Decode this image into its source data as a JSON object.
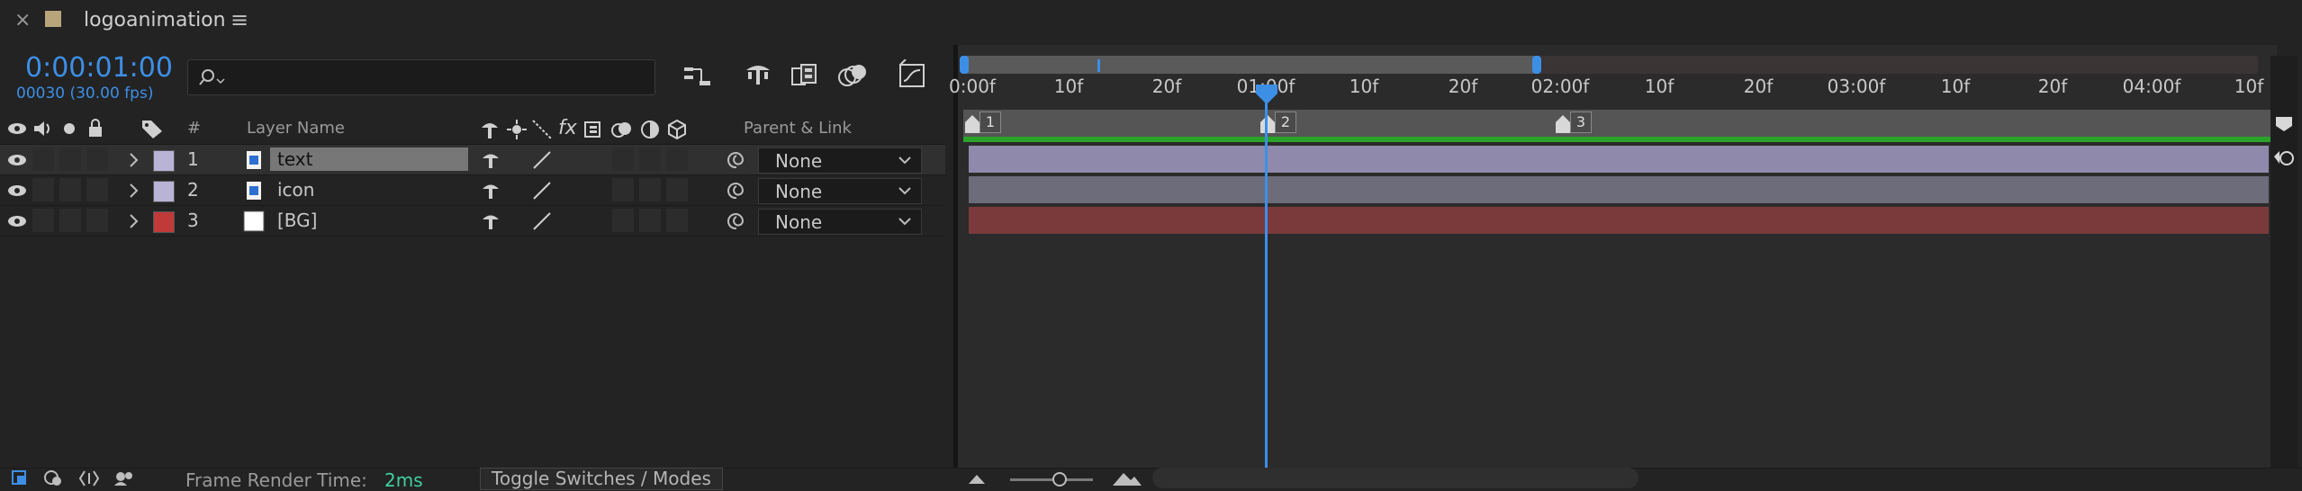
{
  "panel": {
    "close_glyph": "×",
    "comp_name": "logoanimation",
    "menu_glyph": "≡"
  },
  "time": {
    "timecode": "0:00:01:00",
    "frame_fps": "00030 (30.00 fps)"
  },
  "search": {
    "value": "",
    "placeholder": ""
  },
  "columns": {
    "number": "#",
    "layer_name": "Layer Name",
    "parent_link": "Parent & Link",
    "fx": "fx"
  },
  "layers": [
    {
      "index": "1",
      "name": "text",
      "label_color": "#b9b3d6",
      "parent": "None",
      "selected": true
    },
    {
      "index": "2",
      "name": "icon",
      "label_color": "#b9b3d6",
      "parent": "None",
      "selected": false
    },
    {
      "index": "3",
      "name": "[BG]",
      "label_color": "#c03a3a",
      "parent": "None",
      "selected": false
    }
  ],
  "ruler": {
    "labels": [
      "0:00f",
      "10f",
      "20f",
      "01:00f",
      "10f",
      "20f",
      "02:00f",
      "10f",
      "20f",
      "03:00f",
      "10f",
      "20f",
      "04:00f",
      "10f"
    ]
  },
  "markers": [
    "1",
    "2",
    "3"
  ],
  "tracks": [
    {
      "color": "#8f8aab"
    },
    {
      "color": "#6c6c7a"
    },
    {
      "color": "#7a3a3c"
    }
  ],
  "status": {
    "frame_render_label": "Frame Render Time:",
    "frame_render_value": "2ms",
    "toggle_label": "Toggle Switches / Modes"
  },
  "colors": {
    "accent_blue": "#3d8fe6",
    "work_area_green": "#2aa32a",
    "render_time_green": "#40d0a0"
  }
}
